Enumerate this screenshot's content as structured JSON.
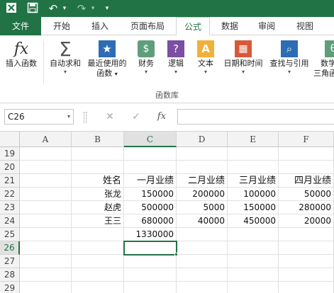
{
  "qat": {
    "undo": "↶",
    "redo": "↷",
    "more": "▾"
  },
  "tabs": [
    "文件",
    "开始",
    "插入",
    "页面布局",
    "公式",
    "数据",
    "审阅",
    "视图"
  ],
  "ribbon": {
    "buttons": [
      {
        "label": "插入函数",
        "label2": "",
        "icon": "fx-icon",
        "glyph": "fx"
      },
      {
        "label": "自动求和",
        "label2": "",
        "icon": "sigma-icon",
        "glyph": "Σ"
      },
      {
        "label": "最近使用的",
        "label2": "函数",
        "icon": "star-icon",
        "glyph": "★"
      },
      {
        "label": "财务",
        "label2": "",
        "icon": "finance-icon",
        "glyph": "$"
      },
      {
        "label": "逻辑",
        "label2": "",
        "icon": "logic-icon",
        "glyph": "?"
      },
      {
        "label": "文本",
        "label2": "",
        "icon": "text-icon",
        "glyph": "A"
      },
      {
        "label": "日期和时间",
        "label2": "",
        "icon": "calendar-icon",
        "glyph": "▦"
      },
      {
        "label": "查找与引用",
        "label2": "",
        "icon": "lookup-icon",
        "glyph": "⌕"
      },
      {
        "label": "数学",
        "label2": "三角函",
        "icon": "math-icon",
        "glyph": "θ"
      }
    ],
    "group_label": "函数库"
  },
  "formula_bar": {
    "name_box": "C26",
    "cancel": "✕",
    "enter": "✓",
    "fx": "fx",
    "value": ""
  },
  "columns": [
    "A",
    "B",
    "C",
    "D",
    "E",
    "F"
  ],
  "rows": [
    "19",
    "20",
    "21",
    "22",
    "23",
    "24",
    "25",
    "26",
    "27",
    "28",
    "29"
  ],
  "cells": {
    "B21": "姓名",
    "C21": "一月业绩",
    "D21": "二月业绩",
    "E21": "三月业绩",
    "F21": "四月业绩",
    "B22": "张龙",
    "C22": "150000",
    "D22": "200000",
    "E22": "100000",
    "F22": "50000",
    "B23": "赵虎",
    "C23": "500000",
    "D23": "5000",
    "E23": "150000",
    "F23": "280000",
    "B24": "王三",
    "C24": "680000",
    "D24": "40000",
    "E24": "450000",
    "F24": "20000",
    "C25": "1330000"
  },
  "selected_cell": "C26",
  "colors": {
    "accent": "#217346"
  }
}
